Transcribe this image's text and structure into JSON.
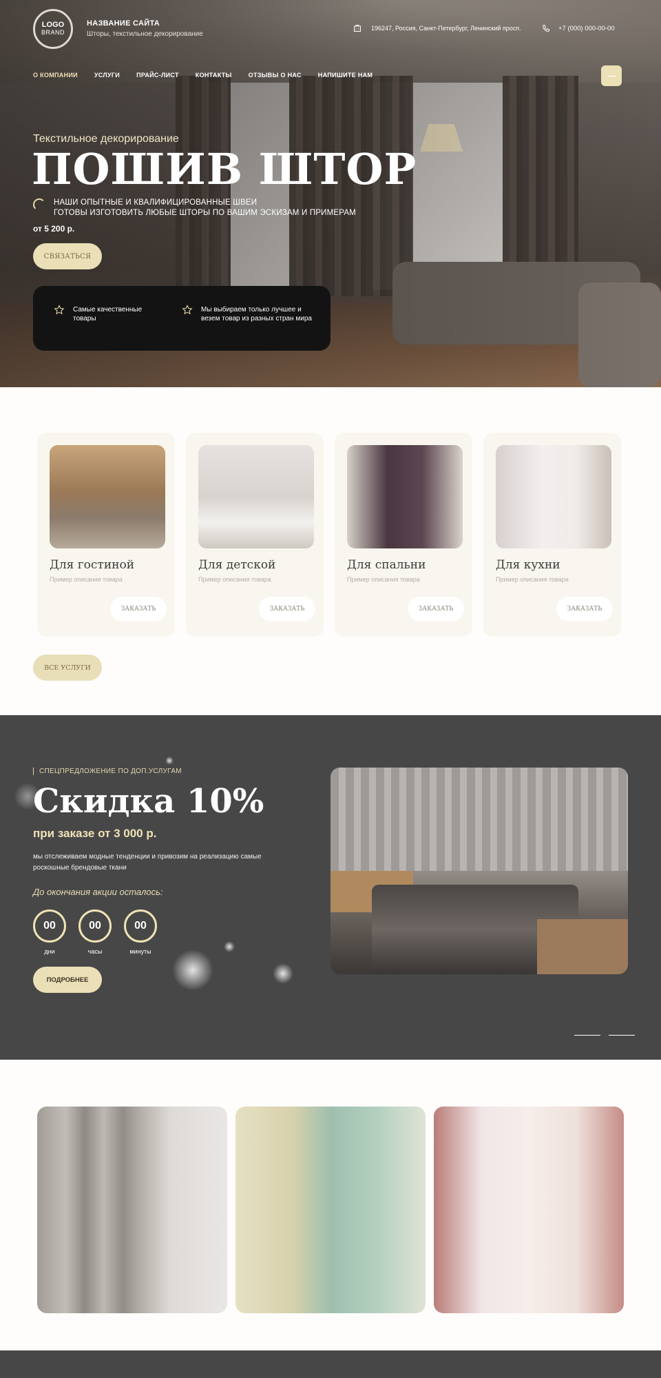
{
  "header": {
    "logo_line1": "LOGO",
    "logo_line2": "BRAND",
    "site_name": "НАЗВАНИЕ САЙТА",
    "site_subtitle": "Шторы, текстильное декорирование",
    "address": "196247, Россия, Санкт-Петербург, Ленинский просп.",
    "phone": "+7 (000) 000-00-00",
    "nav": [
      "О КОМПАНИИ",
      "УСЛУГИ",
      "ПРАЙС-ЛИСТ",
      "КОНТАКТЫ",
      "ОТЗЫВЫ О НАС",
      "НАПИШИТЕ НАМ"
    ]
  },
  "hero": {
    "kicker": "Текстильное декорирование",
    "title": "ПОШИВ ШТОР",
    "desc_line1": "НАШИ ОПЫТНЫЕ И КВАЛИФИЦИРОВАННЫЕ ШВЕИ",
    "desc_line2": "ГОТОВЫ ИЗГОТОВИТЬ ЛЮБЫЕ ШТОРЫ ПО ВАШИМ ЭСКИЗАМ И ПРИМЕРАМ",
    "price": "от 5 200 р.",
    "cta": "СВЯЗАТЬСЯ",
    "features": [
      "Самые качественные товары",
      "Мы выбираем только лучшее и везем товар из разных стран мира"
    ]
  },
  "services": {
    "cards": [
      {
        "title": "Для гостиной",
        "desc": "Пример описания товара",
        "button": "ЗАКАЗАТЬ"
      },
      {
        "title": "Для детской",
        "desc": "Пример описания товара",
        "button": "ЗАКАЗАТЬ"
      },
      {
        "title": "Для спальни",
        "desc": "Пример описания товара",
        "button": "ЗАКАЗАТЬ"
      },
      {
        "title": "Для кухни",
        "desc": "Пример описания товара",
        "button": "ЗАКАЗАТЬ"
      }
    ],
    "all_button": "ВСЕ УСЛУГИ"
  },
  "promo": {
    "kicker": "СПЕЦПРЕДЛОЖЕНИЕ ПО ДОП.УСЛУГАМ",
    "title": "Скидка 10%",
    "subtitle": "при заказе от 3 000 р.",
    "desc": "мы отслеживаем модные тенденции и привозим на реализацию самые роскошные брендовые ткани",
    "countdown_label": "До окончания акции осталось:",
    "timer": [
      {
        "value": "00",
        "unit": "дни"
      },
      {
        "value": "00",
        "unit": "часы"
      },
      {
        "value": "00",
        "unit": "минуты"
      }
    ],
    "button": "ПОДРОБНЕЕ"
  },
  "colors": {
    "accent": "#eadfb6",
    "dark_section": "#474747",
    "card_bg": "#f8f6ee"
  }
}
